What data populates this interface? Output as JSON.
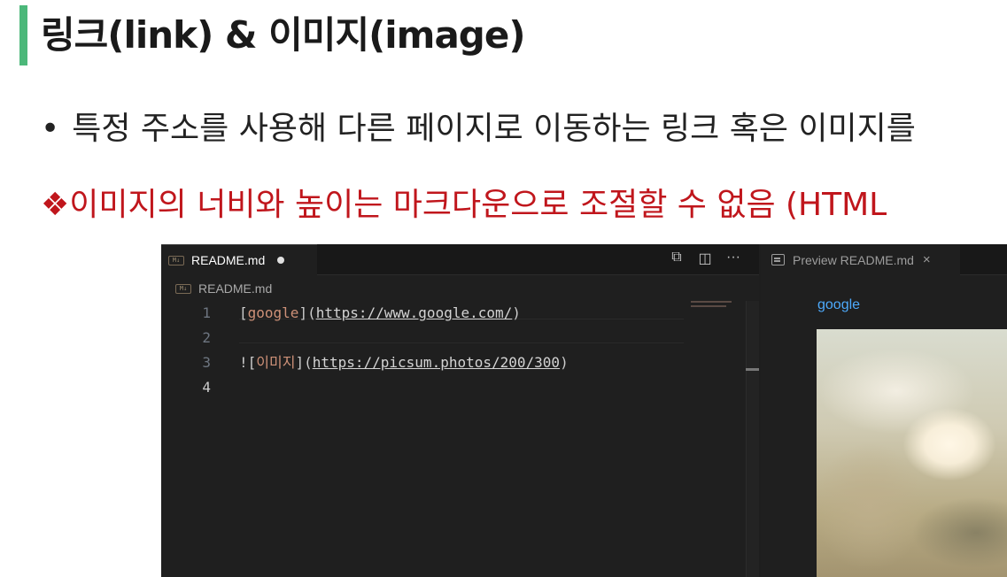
{
  "slide": {
    "title": "링크(link) & 이미지(image)",
    "bullet": "특정 주소를 사용해 다른 페이지로 이동하는 링크 혹은 이미지를",
    "bullet_marker": "•",
    "note": "❖이미지의 너비와 높이는 마크다운으로 조절할 수 없음 (HTML",
    "accent_color": "#4cb87a",
    "note_color": "#c0161c"
  },
  "editor": {
    "tab": {
      "label": "README.md",
      "icon": "markdown-icon",
      "unsaved": true
    },
    "actions": [
      "open-preview-icon",
      "split-editor-icon",
      "more-actions-icon"
    ],
    "action_glyphs": [
      "⧉",
      "◫",
      "···"
    ],
    "breadcrumb": "README.md",
    "lines": [
      {
        "number": "1",
        "open": "[",
        "label": "google",
        "mid": "](",
        "url": "https://www.google.com/",
        "close": ")"
      },
      {
        "number": "2"
      },
      {
        "number": "3",
        "open": "![",
        "label": "이미지",
        "mid": "](",
        "url": "https://picsum.photos/200/300",
        "close": ")"
      },
      {
        "number": "4"
      }
    ]
  },
  "preview": {
    "tab": {
      "label": "Preview README.md",
      "close_glyph": "×"
    },
    "link_text": "google",
    "image_alt": "이미지"
  }
}
